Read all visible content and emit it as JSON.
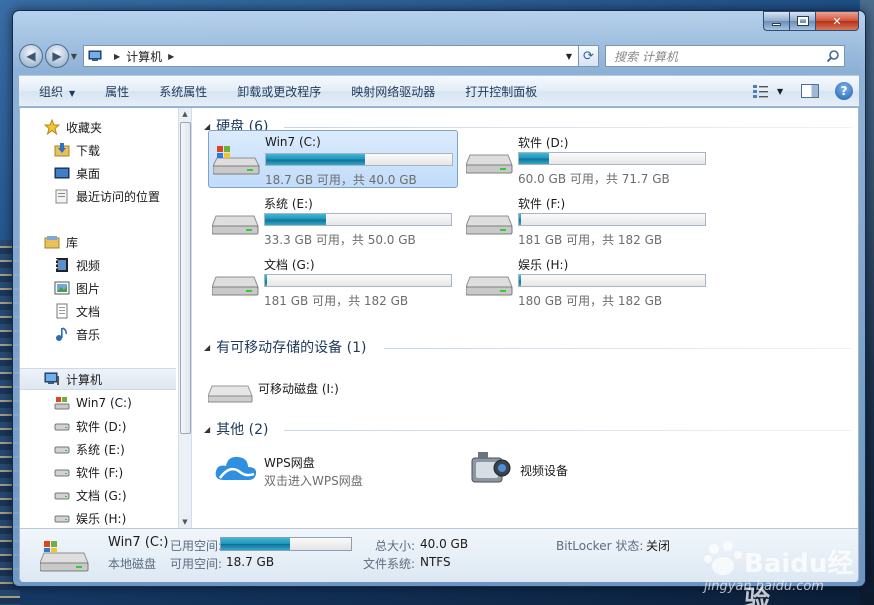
{
  "window": {
    "address_crumb": "计算机",
    "search_placeholder": "搜索 计算机"
  },
  "toolbar": {
    "organize": "组织",
    "properties": "属性",
    "system_properties": "系统属性",
    "uninstall": "卸载或更改程序",
    "map_drive": "映射网络驱动器",
    "control_panel": "打开控制面板"
  },
  "nav": {
    "favorites": "收藏夹",
    "downloads": "下载",
    "desktop": "桌面",
    "recent": "最近访问的位置",
    "libraries": "库",
    "videos": "视频",
    "pictures": "图片",
    "documents": "文档",
    "music": "音乐",
    "computer": "计算机",
    "drives": [
      "Win7 (C:)",
      "软件 (D:)",
      "系统 (E:)",
      "软件 (F:)",
      "文档 (G:)",
      "娱乐 (H:)"
    ]
  },
  "groups": {
    "hdd": "硬盘 (6)",
    "removable": "有可移动存储的设备 (1)",
    "other": "其他 (2)"
  },
  "drives": [
    {
      "name": "Win7 (C:)",
      "free": "18.7 GB 可用，共 40.0 GB",
      "used_fraction": 0.53
    },
    {
      "name": "软件 (D:)",
      "free": "60.0 GB 可用，共 71.7 GB",
      "used_fraction": 0.16
    },
    {
      "name": "系统 (E:)",
      "free": "33.3 GB 可用，共 50.0 GB",
      "used_fraction": 0.33
    },
    {
      "name": "软件 (F:)",
      "free": "181 GB 可用，共 182 GB",
      "used_fraction": 0.006
    },
    {
      "name": "文档 (G:)",
      "free": "181 GB 可用，共 182 GB",
      "used_fraction": 0.006
    },
    {
      "name": "娱乐 (H:)",
      "free": "180 GB 可用，共 182 GB",
      "used_fraction": 0.011
    }
  ],
  "removable": {
    "name": "可移动磁盘 (I:)"
  },
  "other": {
    "wps_name": "WPS网盘",
    "wps_sub": "双击进入WPS网盘",
    "video_device": "视频设备"
  },
  "details": {
    "name": "Win7 (C:)",
    "type": "本地磁盘",
    "used_label": "已用空间:",
    "free_label": "可用空间:",
    "free_value": "18.7 GB",
    "total_label": "总大小:",
    "total_value": "40.0 GB",
    "fs_label": "文件系统:",
    "fs_value": "NTFS",
    "bitlocker_label": "BitLocker 状态:",
    "bitlocker_value": "关闭",
    "used_fraction": 0.53
  },
  "watermark": {
    "brand": "Baidu经验",
    "url": "jingyan.baidu.com"
  },
  "colors": {
    "accent": "#1f92b8",
    "selection": "#c1dcfa",
    "title_text": "#1e395b"
  }
}
